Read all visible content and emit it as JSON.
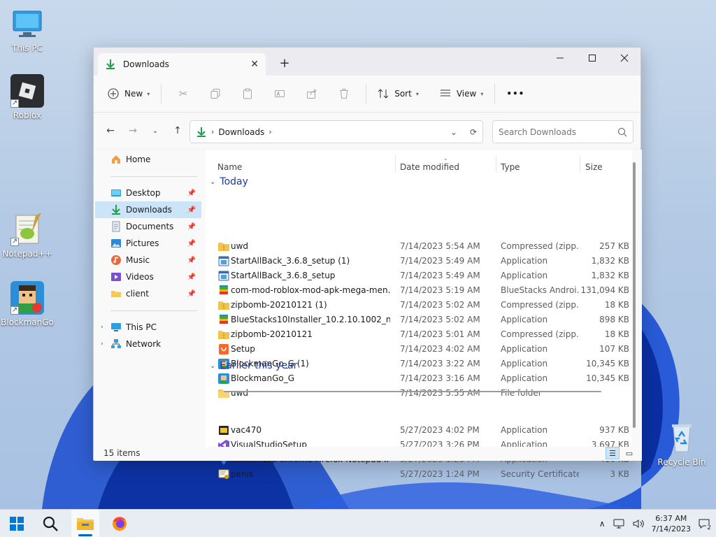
{
  "desktop": {
    "icons": [
      {
        "label": "This PC"
      },
      {
        "label": "Roblox"
      },
      {
        "label": "Notepad++"
      },
      {
        "label": "BlockmanGo"
      },
      {
        "label": "Recycle Bin"
      }
    ]
  },
  "window": {
    "tab_title": "Downloads",
    "new_tab": "+",
    "toolbar": {
      "new_label": "New",
      "sort_label": "Sort",
      "view_label": "View",
      "more_label": "•••"
    },
    "address": {
      "crumb": "Downloads",
      "search_placeholder": "Search Downloads"
    },
    "nav": {
      "home": "Home",
      "quick": [
        {
          "label": "Desktop"
        },
        {
          "label": "Downloads"
        },
        {
          "label": "Documents"
        },
        {
          "label": "Pictures"
        },
        {
          "label": "Music"
        },
        {
          "label": "Videos"
        },
        {
          "label": "client"
        }
      ],
      "this_pc": "This PC",
      "network": "Network"
    },
    "columns": {
      "name": "Name",
      "date": "Date modified",
      "type": "Type",
      "size": "Size"
    },
    "groups": {
      "today": "Today",
      "earlier": "Earlier this year"
    },
    "files_today": [
      {
        "name": "uwd",
        "date": "7/14/2023 5:54 AM",
        "type": "Compressed (zipp...",
        "size": "257 KB",
        "icon": "zip-folder"
      },
      {
        "name": "StartAllBack_3.6.8_setup (1)",
        "date": "7/14/2023 5:49 AM",
        "type": "Application",
        "size": "1,832 KB",
        "icon": "app"
      },
      {
        "name": "StartAllBack_3.6.8_setup",
        "date": "7/14/2023 5:49 AM",
        "type": "Application",
        "size": "1,832 KB",
        "icon": "app"
      },
      {
        "name": "com-mod-roblox-mod-apk-mega-men...",
        "date": "7/14/2023 5:19 AM",
        "type": "BlueStacks Androi...",
        "size": "131,094 KB",
        "icon": "bluestacks"
      },
      {
        "name": "zipbomb-20210121 (1)",
        "date": "7/14/2023 5:02 AM",
        "type": "Compressed (zipp...",
        "size": "18 KB",
        "icon": "zip-folder"
      },
      {
        "name": "BlueStacks10Installer_10.2.10.1002_native...",
        "date": "7/14/2023 5:02 AM",
        "type": "Application",
        "size": "898 KB",
        "icon": "bluestacks"
      },
      {
        "name": "zipbomb-20210121",
        "date": "7/14/2023 5:01 AM",
        "type": "Compressed (zipp...",
        "size": "18 KB",
        "icon": "zip-folder"
      },
      {
        "name": "Setup",
        "date": "7/14/2023 4:02 AM",
        "type": "Application",
        "size": "107 KB",
        "icon": "setup"
      },
      {
        "name": "BlockmanGo_G (1)",
        "date": "7/14/2023 3:22 AM",
        "type": "Application",
        "size": "10,345 KB",
        "icon": "blockman"
      },
      {
        "name": "BlockmanGo_G",
        "date": "7/14/2023 3:16 AM",
        "type": "Application",
        "size": "10,345 KB",
        "icon": "blockman"
      },
      {
        "name": "uwd",
        "date": "7/14/2023 5:55 AM",
        "type": "File folder",
        "size": "",
        "icon": "folder"
      }
    ],
    "files_earlier": [
      {
        "name": "vac470",
        "date": "5/27/2023 4:02 PM",
        "type": "Application",
        "size": "937 KB",
        "icon": "app-dark"
      },
      {
        "name": "VisualStudioSetup",
        "date": "5/27/2023 3:26 PM",
        "type": "Application",
        "size": "3,697 KB",
        "icon": "vs"
      },
      {
        "name": "Ninite 7Zip Chrome Firefox Notepad Inst...",
        "date": "5/27/2023 1:25 PM",
        "type": "Application",
        "size": "416 KB",
        "icon": "ninite"
      },
      {
        "name": "penis",
        "date": "5/27/2023 1:24 PM",
        "type": "Security Certificate",
        "size": "3 KB",
        "icon": "cert"
      }
    ],
    "status": {
      "count": "15 items"
    }
  },
  "taskbar": {
    "time": "6:37 AM",
    "date": "7/14/2023",
    "notif_count": "2"
  },
  "colors": {
    "accent": "#0067c0",
    "selection": "#cce4f7",
    "group_header": "#1f3a93"
  }
}
